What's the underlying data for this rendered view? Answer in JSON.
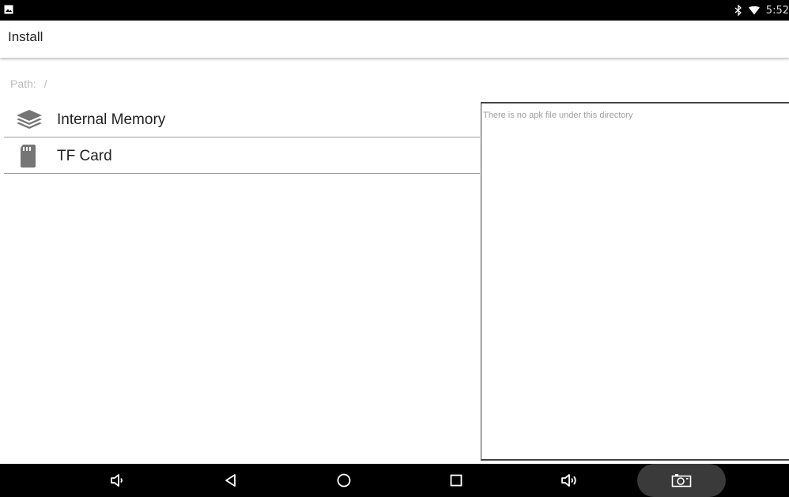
{
  "status_bar": {
    "left_icon": "image-icon",
    "bluetooth_icon": "bluetooth-icon",
    "wifi_icon": "wifi-icon",
    "time": "5:52"
  },
  "app_bar": {
    "title": "Install"
  },
  "path": {
    "label": "Path:",
    "value": "/"
  },
  "storage": {
    "items": [
      {
        "label": "Internal Memory",
        "icon": "layers-icon"
      },
      {
        "label": "TF Card",
        "icon": "sd-card-icon"
      }
    ]
  },
  "file_panel": {
    "empty_message": "There is no apk file under this directory"
  },
  "nav_bar": {
    "buttons": [
      {
        "name": "volume-down",
        "icon": "volume-down-icon"
      },
      {
        "name": "back",
        "icon": "back-icon"
      },
      {
        "name": "home",
        "icon": "home-icon"
      },
      {
        "name": "recents",
        "icon": "recents-icon"
      },
      {
        "name": "volume-up",
        "icon": "volume-up-icon"
      },
      {
        "name": "screenshot",
        "icon": "camera-icon"
      }
    ]
  },
  "colors": {
    "status_bar_bg": "#000000",
    "nav_bar_bg": "#000000",
    "divider": "#9e9e9e",
    "icon_gray": "#757575",
    "hint_text": "#bdbdbd"
  }
}
